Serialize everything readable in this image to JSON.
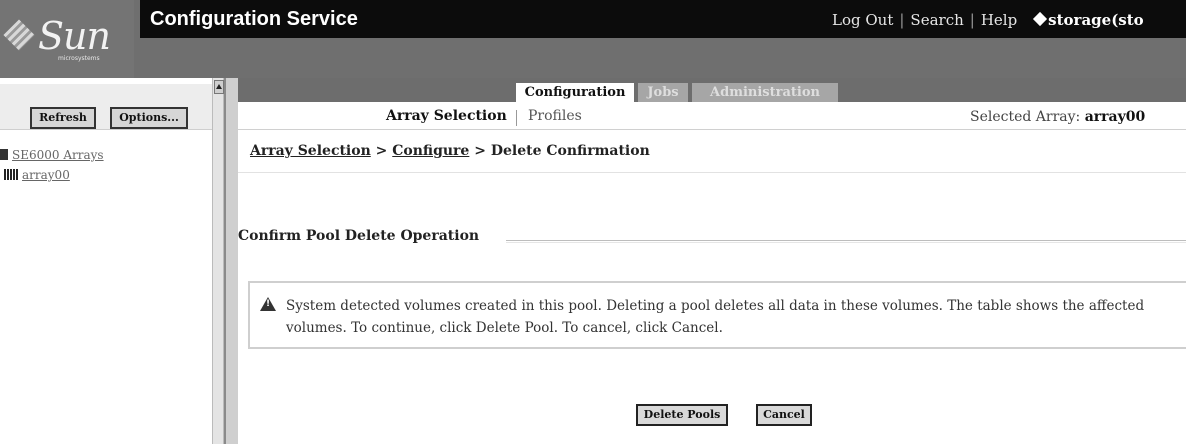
{
  "masthead": {
    "logo_text": "Sun",
    "logo_subtext": "microsystems",
    "app_title": "Configuration Service",
    "links": [
      "Log Out",
      "Search",
      "Help"
    ],
    "storage_label": "storage(sto"
  },
  "left_panel": {
    "refresh_label": "Refresh",
    "options_label": "Options...",
    "tree": {
      "root_label": "SE6000 Arrays",
      "child_label": "array00"
    }
  },
  "tabs": [
    {
      "label": "Configuration",
      "active": true
    },
    {
      "label": "Jobs",
      "active": false
    },
    {
      "label": "Administration",
      "active": false
    }
  ],
  "subtabs": [
    {
      "label": "Array Selection",
      "active": true
    },
    {
      "label": "Profiles",
      "active": false
    }
  ],
  "selected_array": {
    "label": "Selected Array:",
    "value": "array00"
  },
  "breadcrumb": {
    "items": [
      "Array Selection",
      "Configure"
    ],
    "separator": ">",
    "current": "Delete Confirmation"
  },
  "section_title": "Confirm Pool Delete Operation",
  "alert": {
    "icon": "warning-icon",
    "text": "System detected volumes created in this pool. Deleting a pool deletes all data in these volumes. The table shows the affected volumes. To continue, click Delete Pool. To cancel, click Cancel."
  },
  "buttons": {
    "delete_label": "Delete Pools",
    "cancel_label": "Cancel"
  }
}
